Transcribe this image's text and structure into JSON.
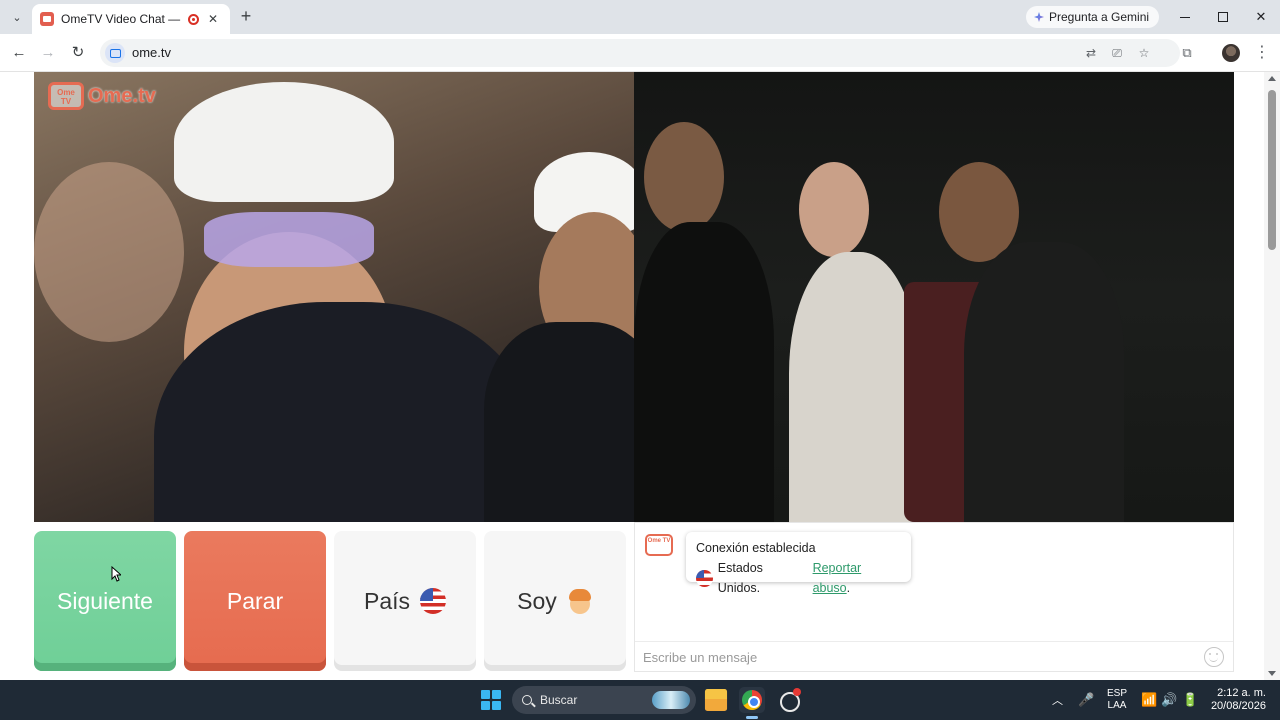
{
  "browser": {
    "tab": {
      "title": "OmeTV Video Chat — Ome",
      "close": "✕"
    },
    "new_tab": "+",
    "gemini_label": "Pregunta a Gemini",
    "url": "ome.tv",
    "window": {
      "close": "✕"
    },
    "nav": {
      "back": "←",
      "forward": "→",
      "reload": "↻"
    },
    "toolbar": {
      "translate": "⇄",
      "install": "⎚",
      "bookmark": "☆",
      "extensions": "⧉",
      "menu": "⋮"
    }
  },
  "page": {
    "logo": {
      "badge": "Ome TV",
      "text": "Ome.tv"
    },
    "buttons": {
      "next": "Siguiente",
      "stop": "Parar",
      "country": "País",
      "gender": "Soy"
    },
    "chat": {
      "logo_badge": "Ome TV",
      "message_title": "Conexión establecida",
      "country": "Estados Unidos.",
      "report_link": "Reportar abuso",
      "report_suffix": ".",
      "input_placeholder": "Escribe un mensaje"
    }
  },
  "taskbar": {
    "search_label": "Buscar",
    "tray": {
      "chevron": "︿",
      "mic": "🎤",
      "lang_top": "ESP",
      "lang_bottom": "LAA",
      "wifi": "📶",
      "volume": "🔊",
      "battery": "🔋"
    },
    "time": "2:12 a. m.",
    "date": "20/08/2026"
  },
  "colors": {
    "next_green": "#6fcf97",
    "stop_red": "#e66b4f",
    "brand_orange": "#e66b52",
    "report_link_green": "#2e9a6b"
  },
  "icons": [
    "tab-list-icon",
    "record-icon",
    "gemini-icon",
    "site-info-icon",
    "translate-icon",
    "install-icon",
    "bookmark-star-icon",
    "extensions-icon",
    "us-flag-icon",
    "boy-emoji-icon",
    "emoji-icon",
    "windows-start-icon",
    "search-icon",
    "file-explorer-icon",
    "chrome-icon"
  ]
}
